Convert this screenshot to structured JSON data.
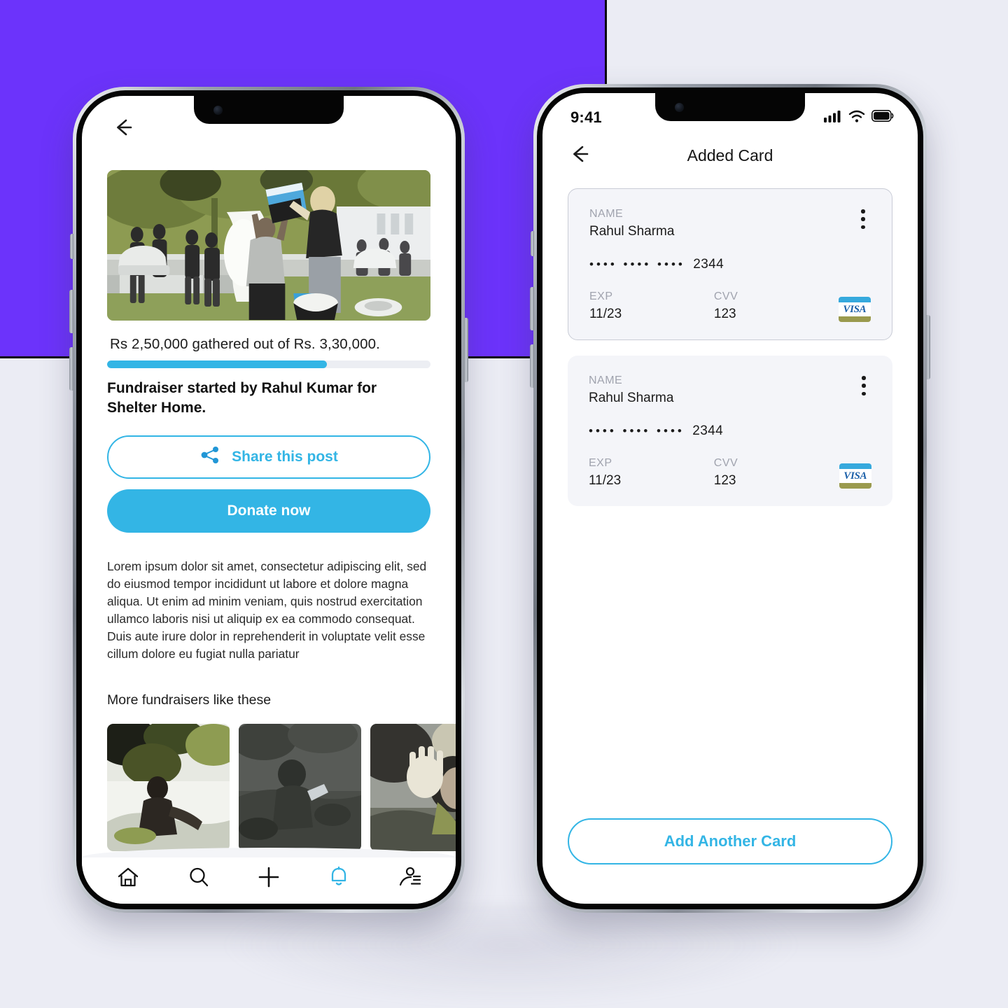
{
  "theme": {
    "purple": "#6c33fb",
    "page_bg": "#ebecf4",
    "accent": "#33b5e5",
    "card_bg": "#f4f5f9"
  },
  "left_phone": {
    "back_icon": "back-arrow-icon",
    "hero_image_alt": "ice-bucket-challenge-crowd-photo",
    "progress": {
      "text": "Rs 2,50,000 gathered out of Rs. 3,30,000.",
      "raised": 250000,
      "goal": 330000,
      "percent": 68
    },
    "fundraiser_title": "Fundraiser started by Rahul Kumar for Shelter Home.",
    "share_button": {
      "label": "Share this post",
      "icon": "share-icon"
    },
    "donate_button": {
      "label": "Donate now"
    },
    "description": "Lorem ipsum dolor sit amet, consectetur adipiscing elit, sed do eiusmod tempor incididunt ut labore et dolore magna aliqua. Ut enim ad minim veniam, quis nostrud exercitation ullamco laboris nisi ut aliquip ex ea commodo consequat. Duis aute irure dolor in reprehenderit in voluptate velit esse cillum dolore eu fugiat nulla pariatur",
    "more_section_title": "More fundraisers like these",
    "thumbnails": [
      {
        "alt": "child-drinking-water-photo"
      },
      {
        "alt": "children-in-mud-photo"
      },
      {
        "alt": "woman-hand-raised-photo"
      }
    ],
    "tabbar": [
      {
        "name": "home",
        "icon": "home-icon",
        "active": false
      },
      {
        "name": "search",
        "icon": "search-icon",
        "active": false
      },
      {
        "name": "add",
        "icon": "plus-icon",
        "active": false
      },
      {
        "name": "notifications",
        "icon": "bell-icon",
        "active": true
      },
      {
        "name": "profile",
        "icon": "profile-list-icon",
        "active": false
      }
    ]
  },
  "right_phone": {
    "status_bar": {
      "time": "9:41",
      "signal_icon": "cellular-signal-icon",
      "wifi_icon": "wifi-icon",
      "battery_icon": "battery-full-icon"
    },
    "header": {
      "title": "Added Card",
      "back_icon": "back-arrow-icon"
    },
    "cards": [
      {
        "name_label": "NAME",
        "name_value": "Rahul Sharma",
        "masked_number": "••••  ••••  ••••",
        "last4": "2344",
        "exp_label": "EXP",
        "exp_value": "11/23",
        "cvv_label": "CVV",
        "cvv_value": "123",
        "brand": "VISA",
        "menu_icon": "kebab-menu-icon",
        "selected": true
      },
      {
        "name_label": "NAME",
        "name_value": "Rahul Sharma",
        "masked_number": "••••  ••••  ••••",
        "last4": "2344",
        "exp_label": "EXP",
        "exp_value": "11/23",
        "cvv_label": "CVV",
        "cvv_value": "123",
        "brand": "VISA",
        "menu_icon": "kebab-menu-icon",
        "selected": false
      }
    ],
    "add_button": {
      "label": "Add Another Card"
    }
  }
}
